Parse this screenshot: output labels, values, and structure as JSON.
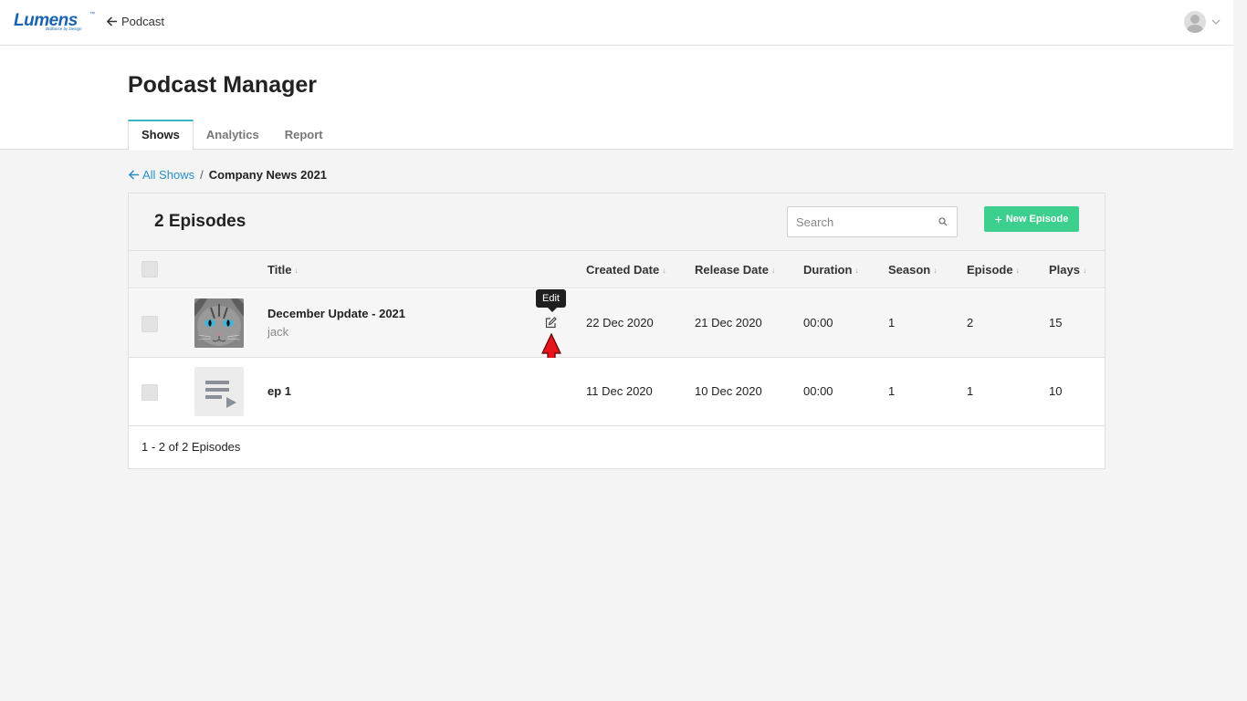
{
  "topbar": {
    "logo": "Lumens",
    "logo_tagline": "Brilliance by Design",
    "back_label": "Podcast"
  },
  "header": {
    "title": "Podcast Manager",
    "tabs": [
      {
        "label": "Shows",
        "active": true
      },
      {
        "label": "Analytics",
        "active": false
      },
      {
        "label": "Report",
        "active": false
      }
    ]
  },
  "breadcrumb": {
    "back_label": "All Shows",
    "separator": "/",
    "current": "Company News 2021"
  },
  "panel": {
    "count_label": "2 Episodes",
    "search_placeholder": "Search",
    "new_button": "New Episode",
    "columns": {
      "title": "Title",
      "created": "Created Date",
      "release": "Release Date",
      "duration": "Duration",
      "season": "Season",
      "episode": "Episode",
      "plays": "Plays"
    },
    "rows": [
      {
        "title": "December Update - 2021",
        "author": "jack",
        "created": "22 Dec 2020",
        "release": "21 Dec 2020",
        "duration": "00:00",
        "season": "1",
        "episode": "2",
        "plays": "15",
        "thumbnail": "cat-photo"
      },
      {
        "title": "ep 1",
        "author": "",
        "created": "11 Dec 2020",
        "release": "10 Dec 2020",
        "duration": "00:00",
        "season": "1",
        "episode": "1",
        "plays": "10",
        "thumbnail": "playlist-placeholder-icon"
      }
    ],
    "tooltip": "Edit",
    "pagination": "1 - 2 of 2 Episodes"
  },
  "colors": {
    "accent_green": "#3ccf8e",
    "link_blue": "#2a8fc7",
    "tab_accent": "#39b7c9",
    "logo_blue": "#1a63b0",
    "annotation_arrow": "#e8141b"
  }
}
